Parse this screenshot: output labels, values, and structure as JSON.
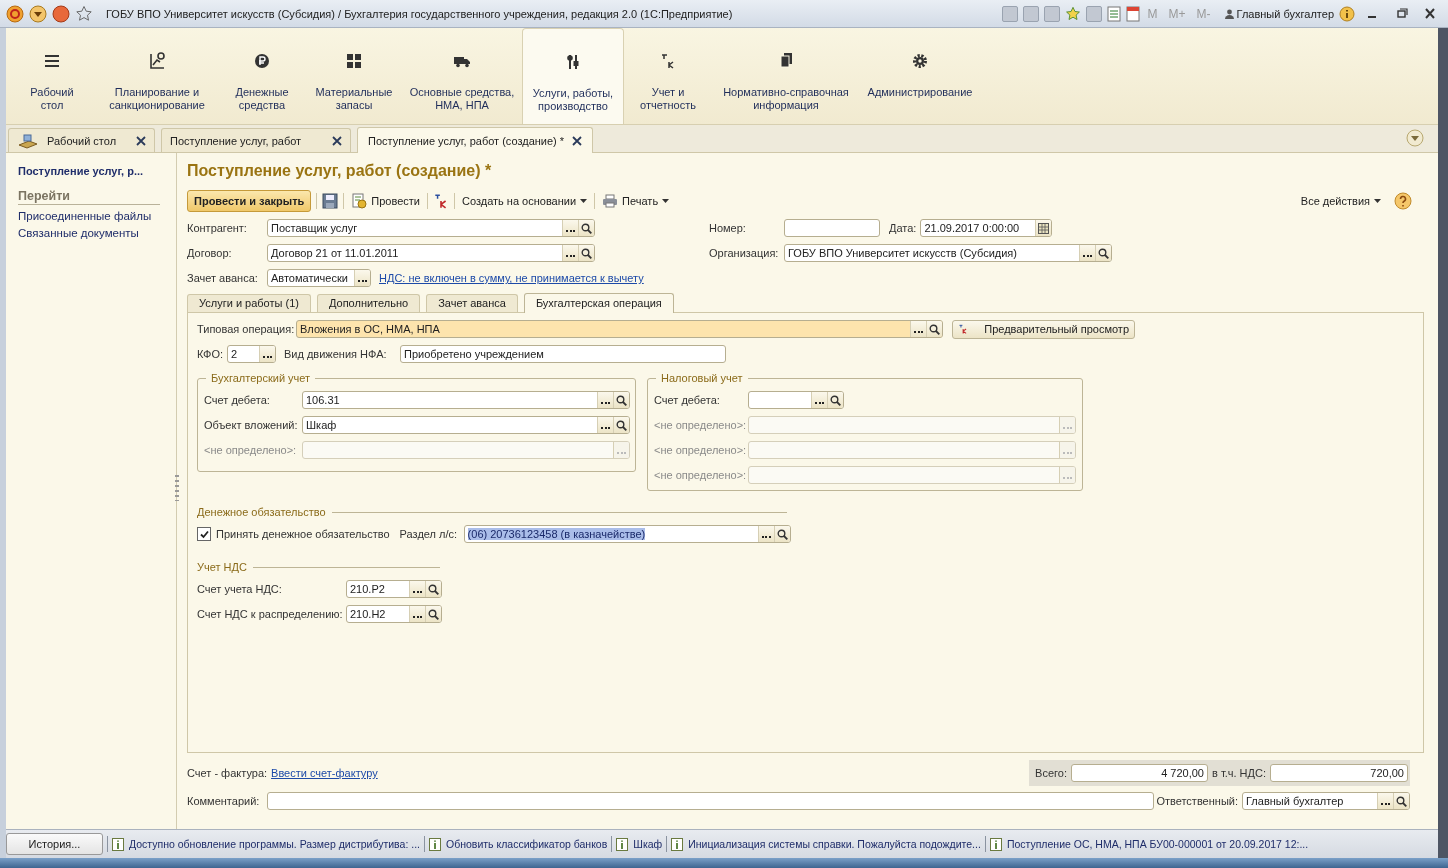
{
  "window": {
    "title": "ГОБУ ВПО Университет искусств (Субсидия) / Бухгалтерия государственного учреждения, редакция 2.0  (1С:Предприятие)",
    "memory_buttons": [
      "M",
      "M+",
      "M-"
    ],
    "user": "Главный бухгалтер"
  },
  "sections": [
    {
      "label": "Рабочий\nстол",
      "selected": false
    },
    {
      "label": "Планирование и\nсанкционирование",
      "selected": false
    },
    {
      "label": "Денежные\nсредства",
      "selected": false
    },
    {
      "label": "Материальные\nзапасы",
      "selected": false
    },
    {
      "label": "Основные средства,\nНМА, НПА",
      "selected": false
    },
    {
      "label": "Услуги, работы,\nпроизводство",
      "selected": true
    },
    {
      "label": "Учет и\nотчетность",
      "selected": false
    },
    {
      "label": "Нормативно-справочная\nинформация",
      "selected": false
    },
    {
      "label": "Администрирование",
      "selected": false
    }
  ],
  "open_tabs": [
    {
      "label": "Рабочий стол",
      "selected": false
    },
    {
      "label": "Поступление услуг, работ",
      "selected": false
    },
    {
      "label": "Поступление услуг, работ (создание) *",
      "selected": true
    }
  ],
  "sidebar": {
    "title": "Поступление услуг, р...",
    "group": "Перейти",
    "links": [
      "Присоединенные файлы",
      "Связанные документы"
    ]
  },
  "form": {
    "title": "Поступление услуг, работ (создание) *",
    "toolbar": {
      "post_close": "Провести и закрыть",
      "post": "Провести",
      "create_based": "Создать на основании",
      "print": "Печать",
      "all_actions": "Все действия"
    },
    "counterparty": {
      "label": "Контрагент:",
      "value": "Поставщик услуг"
    },
    "number": {
      "label": "Номер:"
    },
    "date": {
      "label": "Дата:",
      "value": "21.09.2017  0:00:00"
    },
    "contract": {
      "label": "Договор:",
      "value": "Договор 21 от 11.01.2011"
    },
    "organization": {
      "label": "Организация:",
      "value": "ГОБУ ВПО Университет искусств (Субсидия)"
    },
    "advance": {
      "label": "Зачет аванса:",
      "value": "Автоматически",
      "link": "НДС: не включен в сумму, не принимается к вычету"
    },
    "tabs": [
      {
        "label": "Услуги и работы (1)",
        "selected": false
      },
      {
        "label": "Дополнительно",
        "selected": false
      },
      {
        "label": "Зачет аванса",
        "selected": false
      },
      {
        "label": "Бухгалтерская операция",
        "selected": true
      }
    ],
    "operation": {
      "label": "Типовая операция:",
      "value": "Вложения в ОС, НМА, НПА",
      "preview_button": "Предварительный просмотр"
    },
    "kfo": {
      "label": "КФО:",
      "value": "2"
    },
    "nfa_movement": {
      "label": "Вид движения НФА:",
      "value": "Приобретено учреждением"
    },
    "accounting": {
      "title": "Бухгалтерский учет",
      "rows": [
        {
          "label": "Счет дебета:",
          "value": "106.31",
          "disabled": false
        },
        {
          "label": "Объект вложений:",
          "value": "Шкаф",
          "disabled": false
        },
        {
          "label": "<не определено>:",
          "disabled": true
        }
      ]
    },
    "tax": {
      "title": "Налоговый учет",
      "rows": [
        {
          "label": "Счет дебета:",
          "disabled": false
        },
        {
          "label": "<не определено>:",
          "disabled": true
        },
        {
          "label": "<не определено>:",
          "disabled": true
        },
        {
          "label": "<не определено>:",
          "disabled": true
        }
      ]
    },
    "obligation": {
      "title": "Денежное обязательство",
      "accept": {
        "label": "Принять денежное обязательство",
        "checked": true
      },
      "section": {
        "label": "Раздел л/с:",
        "value": "(06) 20736123458 (в казначействе)",
        "selected": true
      }
    },
    "vat": {
      "title": "Учет НДС",
      "rows": [
        {
          "label": "Счет учета НДС:",
          "value": "210.Р2"
        },
        {
          "label": "Счет НДС к распределению:",
          "value": "210.Н2"
        }
      ]
    },
    "invoice": {
      "label": "Счет - фактура:",
      "link": "Ввести счет-фактуру"
    },
    "totals": {
      "total_label": "Всего:",
      "total": "4 720,00",
      "vat_label": "в т.ч. НДС:",
      "vat": "720,00"
    },
    "comment": {
      "label": "Комментарий:"
    },
    "responsible": {
      "label": "Ответственный:",
      "value": "Главный бухгалтер"
    }
  },
  "status_bar": {
    "history_button": "История...",
    "messages": [
      "Доступно обновление программы. Размер дистрибутива: ...",
      "Обновить классификатор банков",
      "Шкаф",
      "Инициализация системы справки. Пожалуйста подождите...",
      "Поступление ОС, НМА, НПА БУ00-000001 от 20.09.2017 12:..."
    ]
  }
}
